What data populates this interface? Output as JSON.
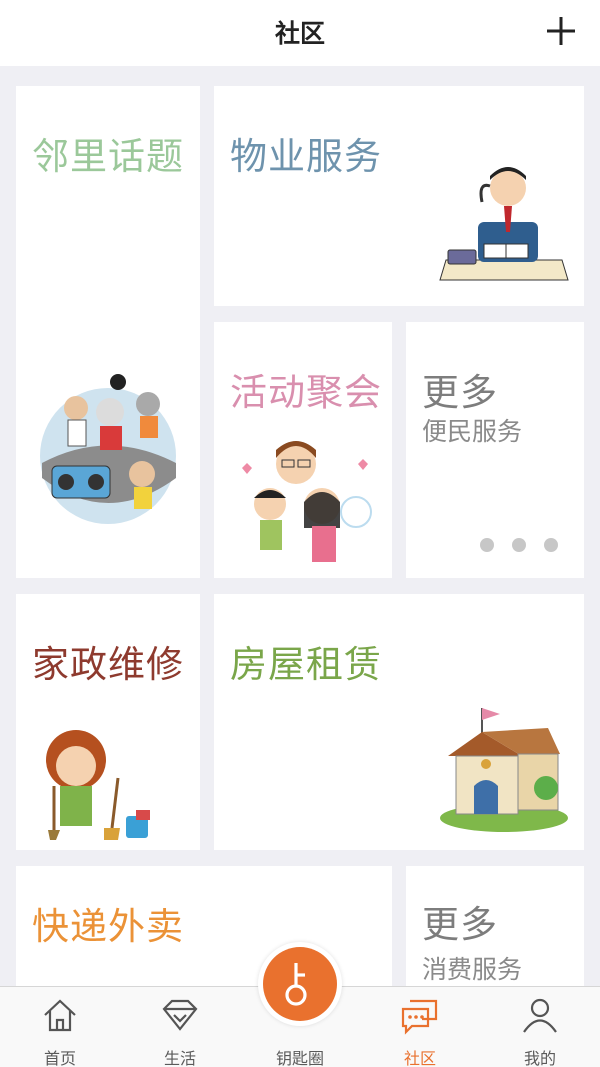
{
  "header": {
    "title": "社区",
    "add_icon": "plus-icon"
  },
  "cards": {
    "neighbor": {
      "title": "邻里话题",
      "color": "#9bc89a"
    },
    "property": {
      "title": "物业服务",
      "color": "#6e93ad"
    },
    "activity": {
      "title": "活动聚会",
      "color": "#d98fae"
    },
    "more_convenience": {
      "title": "更多",
      "subtitle": "便民服务",
      "color": "#7d7d7d"
    },
    "housekeeping": {
      "title": "家政维修",
      "color": "#8e3a2e"
    },
    "rental": {
      "title": "房屋租赁",
      "color": "#7aa64a"
    },
    "delivery": {
      "title": "快递外卖",
      "color": "#eb9237"
    },
    "more_consumption": {
      "title": "更多",
      "subtitle": "消费服务",
      "color": "#7d7d7d"
    }
  },
  "tabbar": {
    "items": [
      {
        "label": "首页",
        "icon": "home-icon",
        "active": false
      },
      {
        "label": "生活",
        "icon": "diamond-icon",
        "active": false
      },
      {
        "label": "钥匙圈",
        "icon": "key-icon",
        "active": false
      },
      {
        "label": "社区",
        "icon": "chat-icon",
        "active": true
      },
      {
        "label": "我的",
        "icon": "person-icon",
        "active": false
      }
    ],
    "accent": "#e9712e"
  }
}
